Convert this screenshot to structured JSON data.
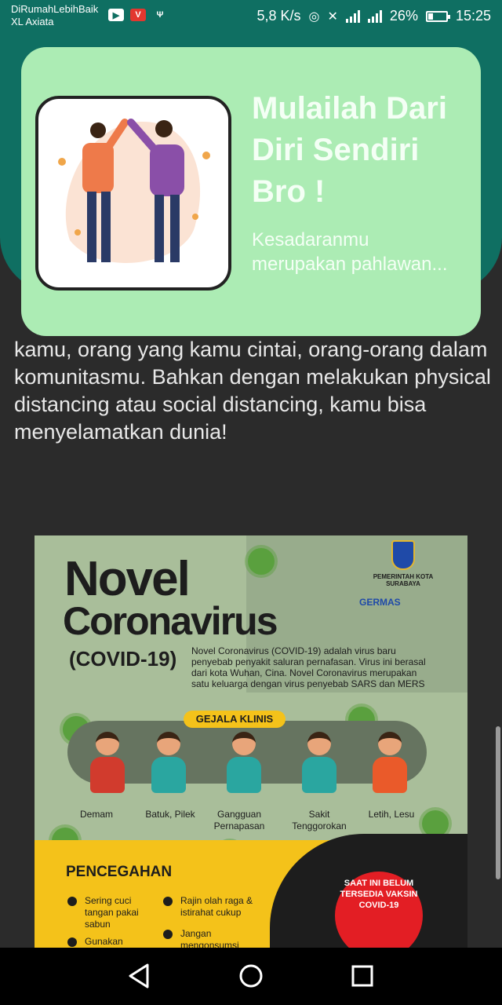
{
  "status_bar": {
    "carrier_line1": "DiRumahLebihBaik",
    "carrier_line2": "XL Axiata",
    "net_speed": "5,8 K/s",
    "battery": "26%",
    "time": "15:25",
    "battery_level": 0.26
  },
  "card": {
    "title": "Mulailah Dari Diri Sendiri Bro !",
    "subtitle": "Kesadaranmu merupakan pahlawan...",
    "image_icon": "two-people-elbow-bump-illustration"
  },
  "article": {
    "text": "kamu, orang yang kamu cintai, orang-orang dalam komunitasmu. Bahkan dengan melakukan physical distancing atau social distancing, kamu bisa menyelamatkan dunia!"
  },
  "poster": {
    "title_line1": "Novel",
    "title_line2": "Coronavirus",
    "title_line3": "(COVID-19)",
    "description": "Novel Coronavirus (COVID-19) adalah virus baru penyebab penyakit saluran pernafasan. Virus ini berasal dari kota Wuhan, Cina. Novel Coronavirus merupakan satu keluarga dengan virus penyebab SARS dan MERS",
    "logo_city": "PEMERINTAH KOTA SURABAYA",
    "logo_germas": "GERMAS",
    "symptoms_heading": "GEJALA KLINIS",
    "symptoms": [
      "Demam",
      "Batuk, Pilek",
      "Gangguan Pernapasan",
      "Sakit Tenggorokan",
      "Letih, Lesu"
    ],
    "prevention_heading": "PENCEGAHAN",
    "prevention_items": [
      "Sering cuci tangan pakai sabun",
      "Gunakan",
      "Rajin olah raga & istirahat cukup",
      "Jangan mengonsumsi"
    ],
    "stamp": "SAAT INI BELUM TERSEDIA VAKSIN COVID-19",
    "colors": {
      "bg": "#a9be9a",
      "yellow": "#f4c21a",
      "red": "#e31e24"
    }
  },
  "colors": {
    "primary_teal": "#0f6f62",
    "card_green": "#acecb4",
    "background": "#2b2b2b"
  }
}
